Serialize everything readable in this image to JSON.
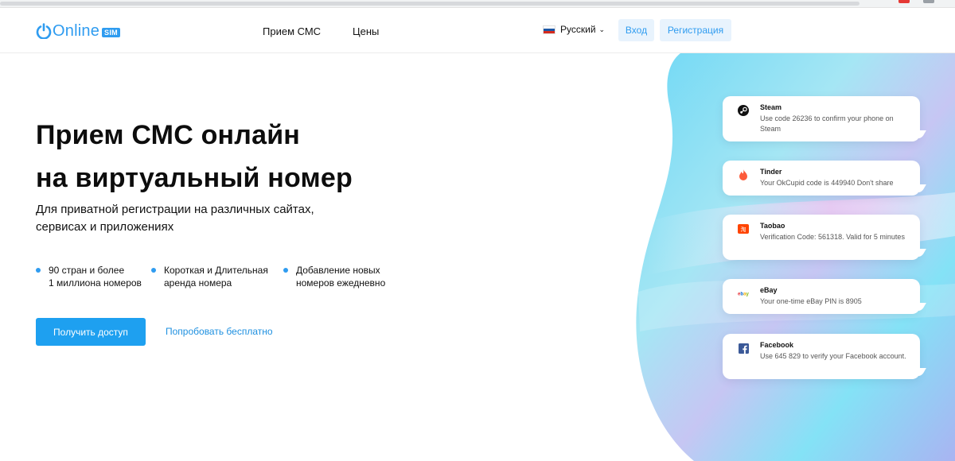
{
  "header": {
    "logo_word": "Online",
    "logo_badge": "SIM",
    "nav": {
      "sms": "Прием СМС",
      "prices": "Цены"
    },
    "language": "Русский",
    "login": "Вход",
    "register": "Регистрация"
  },
  "hero": {
    "title_line1": "Прием СМС онлайн",
    "title_line2": "на виртуальный номер",
    "subtitle_line1": "Для приватной регистрации на различных сайтах,",
    "subtitle_line2": "сервисах и приложениях",
    "features": [
      {
        "line1": "90 стран и более",
        "line2": "1 миллиона номеров"
      },
      {
        "line1": "Короткая и Длительная",
        "line2": "аренда номера"
      },
      {
        "line1": "Добавление новых",
        "line2": "номеров ежедневно"
      }
    ],
    "cta_primary": "Получить доступ",
    "cta_secondary": "Попробовать бесплатно"
  },
  "messages": [
    {
      "service": "Steam",
      "icon": "steam-icon",
      "text": "Use code 26236 to confirm your phone on Steam"
    },
    {
      "service": "Tinder",
      "icon": "tinder-flame-icon",
      "text": "Your OkCupid code is 449940 Don't share"
    },
    {
      "service": "Taobao",
      "icon": "taobao-icon",
      "text": "Verification Code: 561318. Valid for 5 minutes"
    },
    {
      "service": "eBay",
      "icon": "ebay-icon",
      "text": "Your one-time eBay PIN is 8905"
    },
    {
      "service": "Facebook",
      "icon": "facebook-icon",
      "text": "Use 645 829 to verify your Facebook account."
    }
  ],
  "colors": {
    "brand_blue": "#2f9cf0",
    "cta_blue": "#1ea0f0",
    "button_tint": "#e8f3fd",
    "flag_white": "#ffffff",
    "flag_blue": "#1c57a5",
    "flag_red": "#d52b1e",
    "tinder": "#fd5b3a",
    "taobao": "#ff4400",
    "facebook": "#3b5998"
  }
}
